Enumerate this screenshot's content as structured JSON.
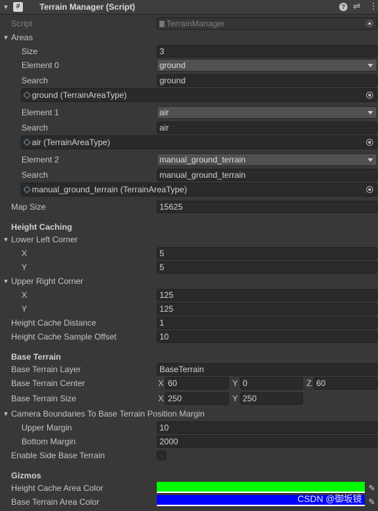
{
  "header": {
    "title": "Terrain Manager (Script)",
    "icon": "#"
  },
  "script": {
    "label": "Script",
    "value": "TerrainManager"
  },
  "areas": {
    "label": "Areas",
    "size_label": "Size",
    "size_value": "3",
    "elements": [
      {
        "label": "Element 0",
        "value": "ground",
        "search_label": "Search",
        "search_value": "ground",
        "object_ref": "ground (TerrainAreaType)"
      },
      {
        "label": "Element 1",
        "value": "air",
        "search_label": "Search",
        "search_value": "air",
        "object_ref": "air (TerrainAreaType)"
      },
      {
        "label": "Element 2",
        "value": "manual_ground_terrain",
        "search_label": "Search",
        "search_value": "manual_ground_terrain",
        "object_ref": "manual_ground_terrain (TerrainAreaType)"
      }
    ]
  },
  "map_size": {
    "label": "Map Size",
    "value": "15625"
  },
  "height_caching": {
    "header": "Height Caching",
    "lower_left": {
      "label": "Lower Left Corner",
      "x_label": "X",
      "x": "5",
      "y_label": "Y",
      "y": "5"
    },
    "upper_right": {
      "label": "Upper Right Corner",
      "x_label": "X",
      "x": "125",
      "y_label": "Y",
      "y": "125"
    },
    "distance": {
      "label": "Height Cache Distance",
      "value": "1"
    },
    "sample_offset": {
      "label": "Height Cache Sample Offset",
      "value": "10"
    }
  },
  "base_terrain": {
    "header": "Base Terrain",
    "layer": {
      "label": "Base Terrain Layer",
      "value": "BaseTerrain"
    },
    "center": {
      "label": "Base Terrain Center",
      "x_label": "X",
      "x": "60",
      "y_label": "Y",
      "y": "0",
      "z_label": "Z",
      "z": "60"
    },
    "size": {
      "label": "Base Terrain Size",
      "x_label": "X",
      "x": "250",
      "y_label": "Y",
      "y": "250"
    },
    "camera": {
      "label": "Camera Boundaries To Base Terrain Position Margin",
      "upper_label": "Upper Margin",
      "upper": "10",
      "bottom_label": "Bottom Margin",
      "bottom": "2000"
    },
    "side": {
      "label": "Enable Side Base Terrain",
      "checked": false
    }
  },
  "gizmos": {
    "header": "Gizmos",
    "height_cache_color": {
      "label": "Height Cache Area Color",
      "color": "#00ff00"
    },
    "base_terrain_color": {
      "label": "Base Terrain Area Color",
      "color": "#0000ff"
    }
  },
  "watermark": "CSDN @御坂镜"
}
